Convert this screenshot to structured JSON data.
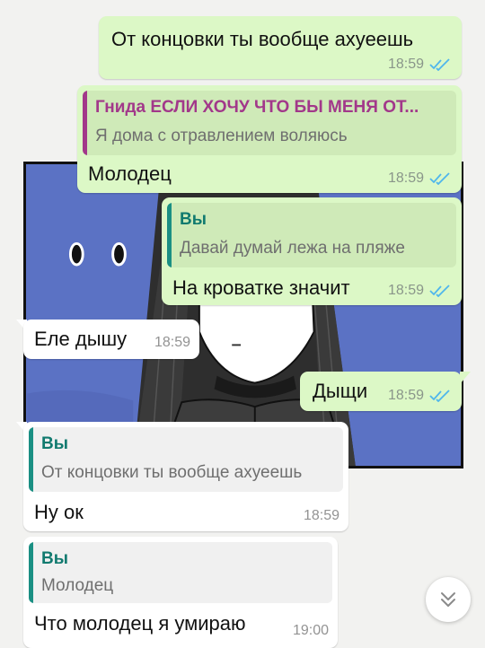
{
  "colors": {
    "outgoing_bubble": "#dcf8c6",
    "incoming_bubble": "#ffffff",
    "read_ticks": "#4fb6ec",
    "author_you": "#117a6f",
    "author_contact": "#a2388a",
    "quote_bar_you": "#1a8f83",
    "quote_bar_contact": "#a2388a",
    "wallpaper": "#5b72c4"
  },
  "messages": [
    {
      "text": "От концовки ты вообще ахуеешь",
      "time": "18:59",
      "status_icon": "double-check-read-icon"
    },
    {
      "quote_author": "Гнида ЕСЛИ ХОЧУ ЧТО БЫ МЕНЯ ОТ...",
      "quote_text": "Я дома с отравлением воляюсь",
      "text": "Молодец",
      "time": "18:59",
      "status_icon": "double-check-read-icon"
    },
    {
      "quote_author": "Вы",
      "quote_text": "Давай думай лежа на пляже",
      "text": "На кроватке значит",
      "time": "18:59",
      "status_icon": "double-check-read-icon"
    },
    {
      "text": "Еле дышу",
      "time": "18:59"
    },
    {
      "text": "Дыщи",
      "time": "18:59",
      "status_icon": "double-check-read-icon"
    },
    {
      "quote_author": "Вы",
      "quote_text": "От концовки ты вообще ахуеешь",
      "text": "Ну ок",
      "time": "18:59"
    },
    {
      "quote_author": "Вы",
      "quote_text": "Молодец",
      "text": "Что молодец я умираю",
      "time": "19:00"
    }
  ],
  "scroll_button": {
    "icon": "double-chevron-down-icon"
  }
}
